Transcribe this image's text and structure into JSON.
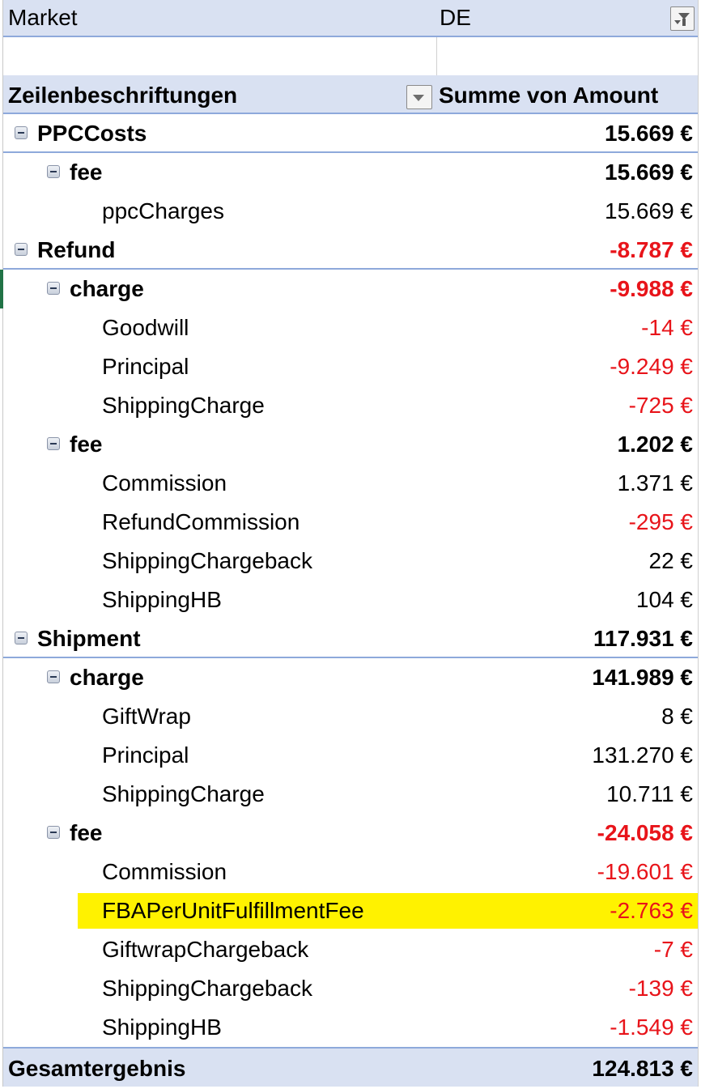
{
  "filter": {
    "field_label": "Market",
    "field_value": "DE",
    "icon": "filter-applied-icon"
  },
  "header": {
    "row_labels": "Zeilenbeschriftungen",
    "values_label": "Summe von Amount",
    "dropdown_icon": "dropdown-arrow-icon"
  },
  "rows": [
    {
      "label": "PPCCosts",
      "value": "15.669 €",
      "level": 0,
      "negative": false
    },
    {
      "label": "fee",
      "value": "15.669 €",
      "level": 1,
      "negative": false
    },
    {
      "label": "ppcCharges",
      "value": "15.669 €",
      "level": 2,
      "negative": false
    },
    {
      "label": "Refund",
      "value": "-8.787 €",
      "level": 0,
      "negative": true
    },
    {
      "label": "charge",
      "value": "-9.988 €",
      "level": 1,
      "negative": true
    },
    {
      "label": "Goodwill",
      "value": "-14 €",
      "level": 2,
      "negative": true
    },
    {
      "label": "Principal",
      "value": "-9.249 €",
      "level": 2,
      "negative": true
    },
    {
      "label": "ShippingCharge",
      "value": "-725 €",
      "level": 2,
      "negative": true
    },
    {
      "label": "fee",
      "value": "1.202 €",
      "level": 1,
      "negative": false
    },
    {
      "label": "Commission",
      "value": "1.371 €",
      "level": 2,
      "negative": false
    },
    {
      "label": "RefundCommission",
      "value": "-295 €",
      "level": 2,
      "negative": true
    },
    {
      "label": "ShippingChargeback",
      "value": "22 €",
      "level": 2,
      "negative": false
    },
    {
      "label": "ShippingHB",
      "value": "104 €",
      "level": 2,
      "negative": false
    },
    {
      "label": "Shipment",
      "value": "117.931 €",
      "level": 0,
      "negative": false
    },
    {
      "label": "charge",
      "value": "141.989 €",
      "level": 1,
      "negative": false
    },
    {
      "label": "GiftWrap",
      "value": "8 €",
      "level": 2,
      "negative": false
    },
    {
      "label": "Principal",
      "value": "131.270 €",
      "level": 2,
      "negative": false
    },
    {
      "label": "ShippingCharge",
      "value": "10.711 €",
      "level": 2,
      "negative": false
    },
    {
      "label": "fee",
      "value": "-24.058 €",
      "level": 1,
      "negative": true
    },
    {
      "label": "Commission",
      "value": "-19.601 €",
      "level": 2,
      "negative": true
    },
    {
      "label": "FBAPerUnitFulfillmentFee",
      "value": "-2.763 €",
      "level": 2,
      "negative": true,
      "highlighted": true
    },
    {
      "label": "GiftwrapChargeback",
      "value": "-7 €",
      "level": 2,
      "negative": true
    },
    {
      "label": "ShippingChargeback",
      "value": "-139 €",
      "level": 2,
      "negative": true
    },
    {
      "label": "ShippingHB",
      "value": "-1.549 €",
      "level": 2,
      "negative": true
    }
  ],
  "total": {
    "label": "Gesamtergebnis",
    "value": "124.813 €"
  },
  "colors": {
    "header_bg": "#d9e1f2",
    "border_accent": "#8ea9db",
    "negative_text": "#e8141a",
    "highlight": "#fff200",
    "selection": "#217346"
  }
}
